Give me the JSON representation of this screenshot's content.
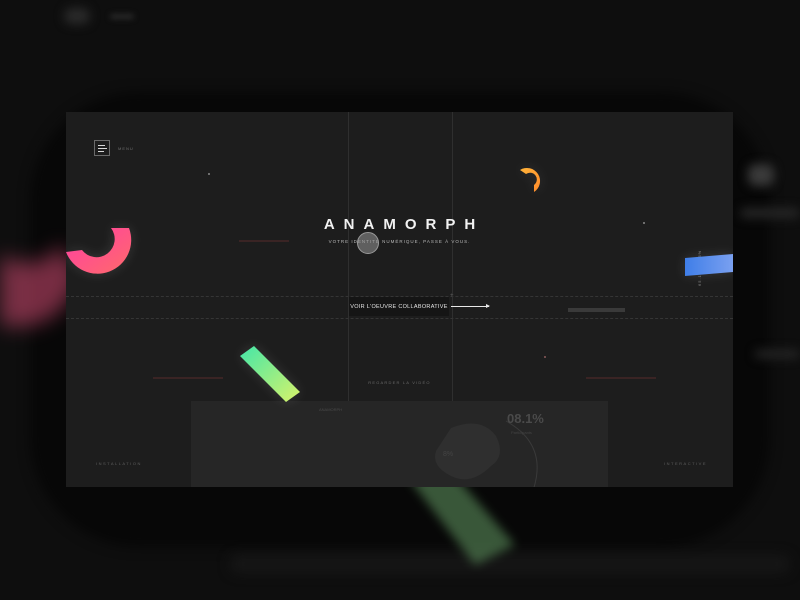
{
  "header": {
    "menu_label": "MENU"
  },
  "hero": {
    "title": "ANAMORPH",
    "subtitle": "VOTRE IDENTITÉ NUMÉRIQUE, PASSE À VOUS.",
    "cta_label": "VOIR L'OEUVRE COLLABORATIVE",
    "video_link": "REGARDER LA VIDÉO"
  },
  "footer": {
    "left_label": "INSTALLATION",
    "right_label": "INTERACTIVE"
  },
  "side": {
    "code": "65.1W - 1.5%"
  },
  "preview": {
    "big_value": "08.1%",
    "caption": "Participants",
    "small_label": "ANAMORPH",
    "percent": "8%"
  },
  "colors": {
    "background": "#0e0e0e",
    "screen": "#1d1d1d",
    "accent_pink": "#ff5d8f",
    "accent_orange": "#ff9a2e",
    "accent_blue": "#4a78e8",
    "accent_green": "#5ee89a"
  }
}
